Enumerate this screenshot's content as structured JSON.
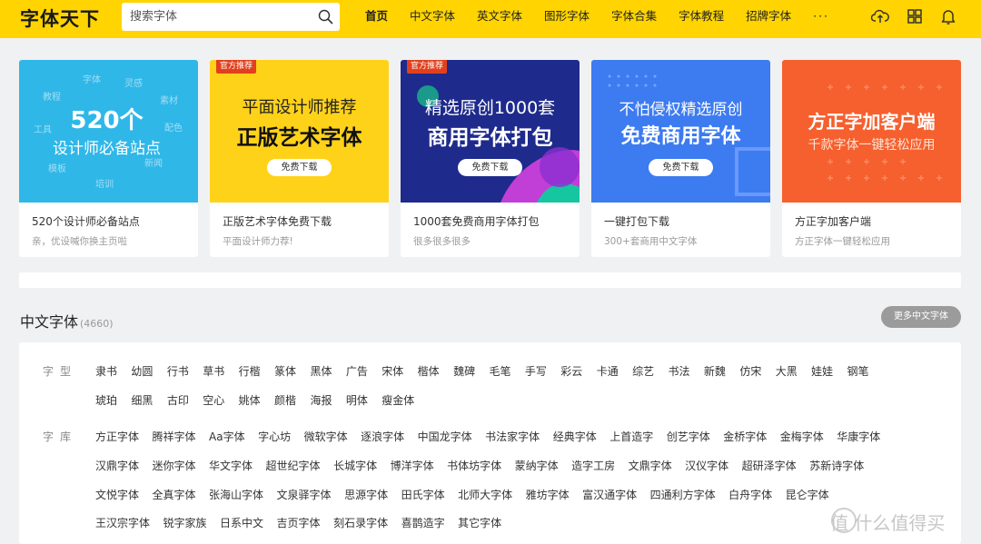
{
  "header": {
    "logo": "字体天下",
    "search": {
      "placeholder": "搜索字体"
    },
    "nav": [
      "首页",
      "中文字体",
      "英文字体",
      "图形字体",
      "字体合集",
      "字体教程",
      "招牌字体"
    ],
    "nav_more": "···",
    "icons": [
      "upload-cloud-icon",
      "apps-grid-icon",
      "bell-icon"
    ],
    "accent_color": "#ffd400"
  },
  "cards": [
    {
      "tag": "",
      "headline": [
        "520个",
        "设计师必备站点"
      ],
      "cloud_words": [
        "字体",
        "灵感",
        "教程",
        "素材",
        "工具",
        "配色",
        "模板",
        "新闻",
        "培训"
      ],
      "button": "",
      "title": "520个设计师必备站点",
      "subtitle": "亲，优设喊你换主页啦",
      "bg": "#2fb7e8"
    },
    {
      "tag": "官方推荐",
      "headline": [
        "平面设计师推荐",
        "正版艺术字体"
      ],
      "button": "免费下载",
      "title": "正版艺术字体免费下载",
      "subtitle": "平面设计师力荐!",
      "bg": "#ffd21a"
    },
    {
      "tag": "官方推荐",
      "headline": [
        "精选原创1000套",
        "商用字体打包"
      ],
      "button": "免费下载",
      "title": "1000套免费商用字体打包",
      "subtitle": "很多很多很多",
      "bg": "#1e2a8c"
    },
    {
      "tag": "",
      "headline": [
        "不怕侵权精选原创",
        "免费商用字体"
      ],
      "button": "免费下载",
      "title": "一键打包下载",
      "subtitle": "300+套商用中文字体",
      "bg": "#3d7bf0"
    },
    {
      "tag": "",
      "headline": [
        "方正字加客户端",
        "千款字体一键轻松应用"
      ],
      "button": "",
      "title": "方正字加客户端",
      "subtitle": "方正字体一键轻松应用",
      "bg": "#f5602e"
    }
  ],
  "section": {
    "title": "中文字体",
    "count": "(4660)",
    "more_button": "更多中文字体"
  },
  "filters": {
    "style_label": "字型",
    "style_rows": [
      [
        "隶书",
        "幼圆",
        "行书",
        "草书",
        "行楷",
        "篆体",
        "黑体",
        "广告",
        "宋体",
        "楷体",
        "魏碑",
        "毛笔",
        "手写",
        "彩云",
        "卡通",
        "综艺",
        "书法",
        "新魏",
        "仿宋",
        "大黑",
        "娃娃",
        "钢笔"
      ],
      [
        "琥珀",
        "细黑",
        "古印",
        "空心",
        "姚体",
        "颜楷",
        "海报",
        "明体",
        "瘦金体"
      ]
    ],
    "library_label": "字库",
    "library_rows": [
      [
        "方正字体",
        "腾祥字体",
        "Aa字体",
        "字心坊",
        "微软字体",
        "逐浪字体",
        "中国龙字体",
        "书法家字体",
        "经典字体",
        "上首造字",
        "创艺字体",
        "金桥字体",
        "金梅字体",
        "华康字体"
      ],
      [
        "汉鼎字体",
        "迷你字体",
        "华文字体",
        "超世纪字体",
        "长城字体",
        "博洋字体",
        "书体坊字体",
        "蒙纳字体",
        "造字工房",
        "文鼎字体",
        "汉仪字体",
        "超研泽字体",
        "苏新诗字体"
      ],
      [
        "文悦字体",
        "全真字体",
        "张海山字体",
        "文泉驿字体",
        "思源字体",
        "田氏字体",
        "北师大字体",
        "雅坊字体",
        "富汉通字体",
        "四通利方字体",
        "白舟字体",
        "昆仑字体"
      ],
      [
        "王汉宗字体",
        "锐字家族",
        "日系中文",
        "吉页字体",
        "刻石录字体",
        "喜鹊造字",
        "其它字体"
      ]
    ]
  },
  "watermark": "值 什么值得买"
}
